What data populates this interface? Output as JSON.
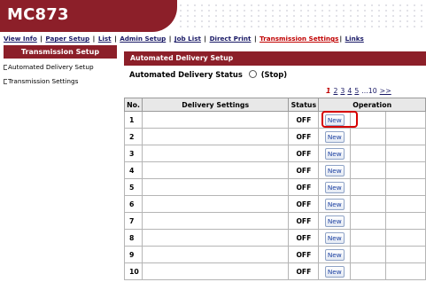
{
  "header": {
    "brand": "MC873"
  },
  "nav": {
    "items": [
      {
        "label": "View Info"
      },
      {
        "label": "Paper Setup"
      },
      {
        "label": "List"
      },
      {
        "label": "Admin Setup"
      },
      {
        "label": "Job List"
      },
      {
        "label": "Direct Print"
      },
      {
        "label": "Transmission Settings"
      },
      {
        "label": "Links"
      }
    ]
  },
  "sidebar": {
    "title": "Transmission Setup",
    "items": [
      {
        "label": "Automated Delivery Setup"
      },
      {
        "label": "Transmission Settings"
      }
    ]
  },
  "main": {
    "section_title": "Automated Delivery Setup",
    "status_label": "Automated Delivery Status",
    "status_value": "(Stop)",
    "pager": [
      "1",
      "2",
      "3",
      "4",
      "5",
      "...10",
      ">>"
    ],
    "columns": [
      "No.",
      "Delivery Settings",
      "Status",
      "Operation"
    ],
    "rows": [
      {
        "no": "1",
        "settings": "",
        "status": "OFF",
        "button": "New"
      },
      {
        "no": "2",
        "settings": "",
        "status": "OFF",
        "button": "New"
      },
      {
        "no": "3",
        "settings": "",
        "status": "OFF",
        "button": "New"
      },
      {
        "no": "4",
        "settings": "",
        "status": "OFF",
        "button": "New"
      },
      {
        "no": "5",
        "settings": "",
        "status": "OFF",
        "button": "New"
      },
      {
        "no": "6",
        "settings": "",
        "status": "OFF",
        "button": "New"
      },
      {
        "no": "7",
        "settings": "",
        "status": "OFF",
        "button": "New"
      },
      {
        "no": "8",
        "settings": "",
        "status": "OFF",
        "button": "New"
      },
      {
        "no": "9",
        "settings": "",
        "status": "OFF",
        "button": "New"
      },
      {
        "no": "10",
        "settings": "",
        "status": "OFF",
        "button": "New"
      }
    ]
  },
  "colors": {
    "banner": "#8c1f29",
    "link": "#1a1a66",
    "active_link": "#c00000",
    "highlight": "#d60000"
  }
}
